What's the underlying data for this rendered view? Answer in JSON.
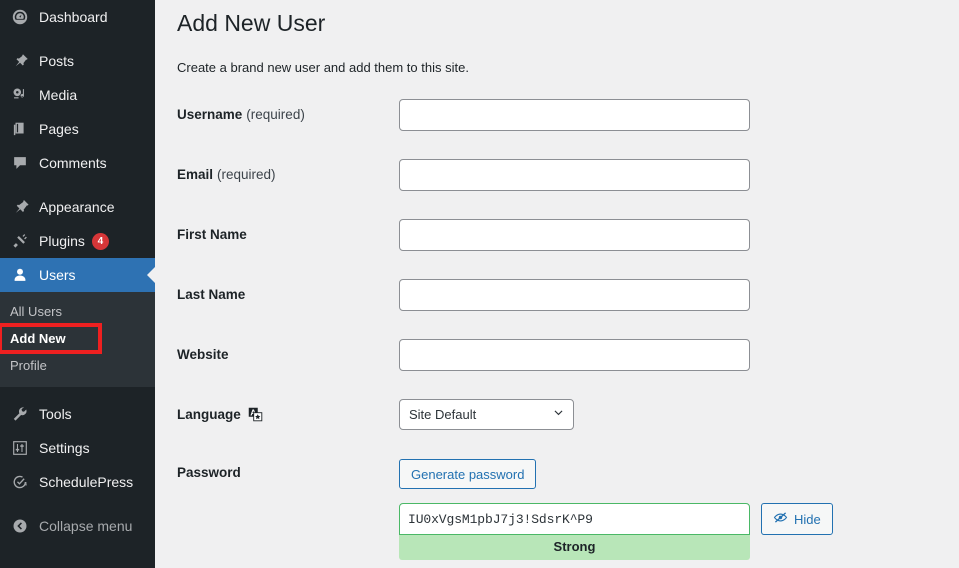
{
  "sidebar": {
    "items": [
      {
        "label": "Dashboard",
        "icon": "dashboard-icon",
        "active": false
      },
      {
        "label": "Posts",
        "icon": "pin-icon",
        "active": false
      },
      {
        "label": "Media",
        "icon": "media-icon",
        "active": false
      },
      {
        "label": "Pages",
        "icon": "pages-icon",
        "active": false
      },
      {
        "label": "Comments",
        "icon": "comments-icon",
        "active": false
      },
      {
        "label": "Appearance",
        "icon": "appearance-icon",
        "active": false
      },
      {
        "label": "Plugins",
        "icon": "plugins-icon",
        "badge": "4",
        "active": false
      },
      {
        "label": "Users",
        "icon": "users-icon",
        "active": true
      },
      {
        "label": "Tools",
        "icon": "wrench-icon",
        "active": false
      },
      {
        "label": "Settings",
        "icon": "settings-icon",
        "active": false
      },
      {
        "label": "SchedulePress",
        "icon": "schedulepress-icon",
        "active": false
      },
      {
        "label": "Collapse menu",
        "icon": "collapse-icon",
        "active": false
      }
    ],
    "submenu": [
      {
        "label": "All Users",
        "current": false,
        "highlighted": false
      },
      {
        "label": "Add New",
        "current": true,
        "highlighted": true
      },
      {
        "label": "Profile",
        "current": false,
        "highlighted": false
      }
    ]
  },
  "main": {
    "title": "Add New User",
    "description": "Create a brand new user and add them to this site.",
    "fields": {
      "username": {
        "label": "Username",
        "required_note": "(required)",
        "value": "",
        "placeholder": ""
      },
      "email": {
        "label": "Email",
        "required_note": "(required)",
        "value": "",
        "placeholder": ""
      },
      "first_name": {
        "label": "First Name",
        "required_note": "",
        "value": "",
        "placeholder": ""
      },
      "last_name": {
        "label": "Last Name",
        "required_note": "",
        "value": "",
        "placeholder": ""
      },
      "website": {
        "label": "Website",
        "required_note": "",
        "value": "",
        "placeholder": ""
      },
      "language": {
        "label": "Language",
        "selected": "Site Default",
        "icon": "translate-icon"
      },
      "password": {
        "label": "Password",
        "generate_button": "Generate password",
        "value": "IU0xVgsM1pbJ7j3!SdsrK^P9",
        "strength": "Strong",
        "hide_button": "Hide",
        "hide_icon": "eye-slash-icon"
      }
    }
  },
  "colors": {
    "sidebar_bg": "#1d2327",
    "submenu_bg": "#2c3338",
    "active_blue": "#2e72b3",
    "accent_blue": "#2271b1",
    "badge_red": "#d63638",
    "highlight_red": "#ef2020",
    "strength_green": "#b8e6b8",
    "page_bg": "#f0f0f1"
  }
}
